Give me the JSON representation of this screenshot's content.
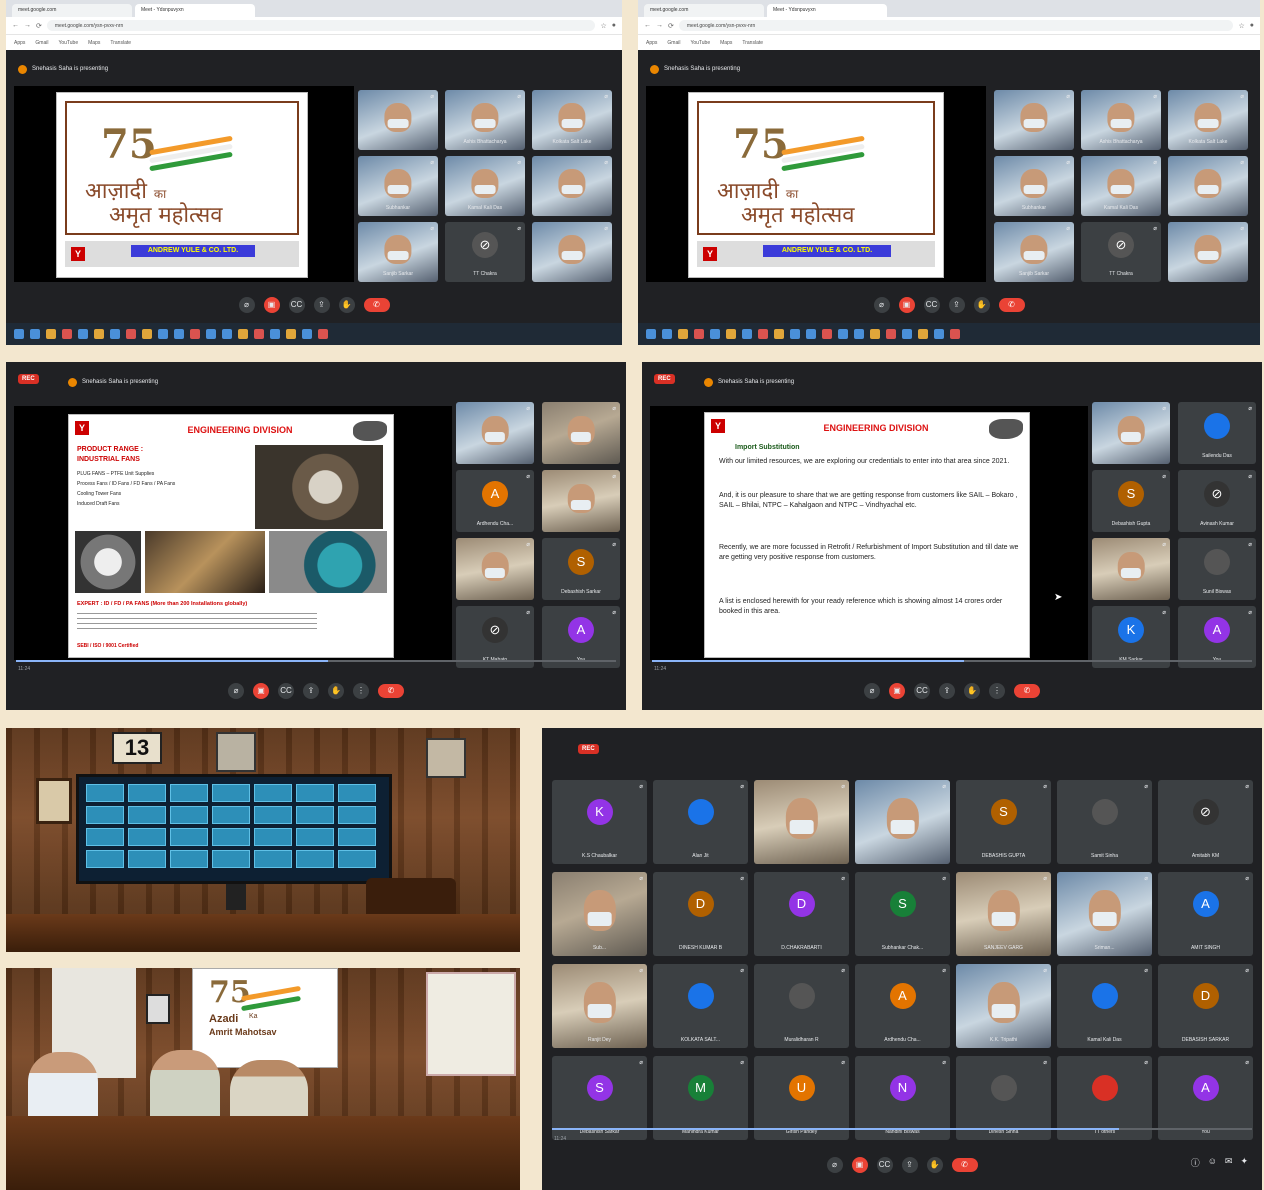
{
  "colors": {
    "meet_bg": "#202124",
    "tile_bg": "#3c4043",
    "hangup_red": "#ea4335",
    "rec_red": "#d93025",
    "presenting_dot": "#ea8600",
    "accent_blue": "#1a73e8",
    "background": "#f3e7cf"
  },
  "icons": [
    "mic-off-icon",
    "camera-icon",
    "captions-icon",
    "present-icon",
    "raise-hand-icon",
    "more-icon",
    "hangup-icon",
    "info-icon",
    "people-icon",
    "chat-icon",
    "activities-icon",
    "pin-icon",
    "back-icon",
    "forward-icon",
    "reload-icon",
    "star-icon",
    "profile-icon"
  ],
  "browser": {
    "tab1": "meet.google.com",
    "tab2": "Meet - Ydsnpuvyxn",
    "address": "meet.google.com/ysn-pvxv-nrn",
    "bookmarks": [
      "Apps",
      "Gmail",
      "YouTube",
      "Maps",
      "Translate"
    ]
  },
  "screens": {
    "presenting": "Snehasis Saha is presenting",
    "presenting_b": "Snehasis Saha is presenting",
    "rec": "REC",
    "meeting_code": "ysn-pvxv-nrn",
    "time": "11:24"
  },
  "logo_slide": {
    "seventyfive": "75",
    "hindi1": "आज़ादी",
    "ka": "का",
    "hindi2": "अमृत महोत्सव",
    "company": "ANDREW YULE & CO. LTD.",
    "company_logo": "Y"
  },
  "top_tiles": [
    {
      "name": "",
      "type": "video"
    },
    {
      "name": "Ashis Bhattacharya",
      "type": "video"
    },
    {
      "name": "Kolkata Salt Lake",
      "type": "video"
    },
    {
      "name": "Subhankar",
      "type": "video"
    },
    {
      "name": "Kamal Kali Das",
      "type": "video"
    },
    {
      "name": "",
      "type": "video"
    },
    {
      "name": "Sanjib Sarkar",
      "type": "video"
    },
    {
      "name": "TT Chakra",
      "type": "avatar",
      "letter": "⊘"
    },
    {
      "name": "",
      "type": "video"
    }
  ],
  "slide_eng": {
    "title": "ENGINEERING DIVISION",
    "heading1": "PRODUCT RANGE :",
    "heading2": "INDUSTRIAL FANS",
    "bullets": [
      "PLUG FANS – PTFE Unit Supplies",
      "Process Fans / ID Fans / FD Fans / PA Fans",
      "Cooling Tower Fans",
      "Induced Draft Fans"
    ],
    "expert": "EXPERT : ID / FD / PA FANS (More than 200 Installations globally)",
    "footer": "SEBI / ISO / 9001 Certified"
  },
  "slide_import": {
    "title": "ENGINEERING DIVISION",
    "sub": "Import Substitution",
    "bullets": [
      "With our limited resources, we are exploring our credentials to enter into that area since 2021.",
      "And, it is our pleasure to share that we are getting response from customers like SAIL – Bokaro , SAIL – Bhilai, NTPC – Kahalgaon and NTPC – Vindhyachal etc.",
      "Recently, we are more focussed in Retrofit / Refurbishment of Import Substitution and till date we are getting very positive response from customers.",
      "A list is enclosed herewith for your ready reference which is showing almost 14 crores order booked in this area."
    ]
  },
  "mid_tiles_left": [
    {
      "name": "",
      "type": "video"
    },
    {
      "name": "",
      "type": "video"
    },
    {
      "name": "Ardhendu Cha...",
      "type": "avatar",
      "letter": "A",
      "color": "#e37400"
    },
    {
      "name": "",
      "type": "video"
    },
    {
      "name": "",
      "type": "video"
    },
    {
      "name": "Debashish Sarkar",
      "type": "avatar",
      "letter": "S",
      "color": "#b06000"
    },
    {
      "name": "KT Mahato",
      "type": "avatar",
      "letter": "⊘",
      "color": "#333"
    },
    {
      "name": "You",
      "type": "avatar",
      "letter": "A",
      "color": "#9334e6"
    }
  ],
  "mid_tiles_right": [
    {
      "name": "",
      "type": "video"
    },
    {
      "name": "Sailendu Das",
      "type": "avatar",
      "letter": "",
      "color": "#1a73e8"
    },
    {
      "name": "Debashish Gupta",
      "type": "avatar",
      "letter": "S",
      "color": "#b06000"
    },
    {
      "name": "Avinash Kumar",
      "type": "avatar",
      "letter": "⊘",
      "color": "#333"
    },
    {
      "name": "",
      "type": "video"
    },
    {
      "name": "Sunil Biswas",
      "type": "avatar",
      "letter": "",
      "color": "#555"
    },
    {
      "name": "KM Sarkar",
      "type": "avatar",
      "letter": "K",
      "color": "#1a73e8"
    },
    {
      "name": "You",
      "type": "avatar",
      "letter": "A",
      "color": "#9334e6"
    }
  ],
  "grid_tiles": [
    {
      "name": "K.S Chaubalkar",
      "letter": "K",
      "color": "#9334e6",
      "type": "avatar"
    },
    {
      "name": "Alan Jit",
      "letter": "",
      "color": "#1a73e8",
      "type": "avatar"
    },
    {
      "name": "",
      "type": "video"
    },
    {
      "name": "",
      "type": "video"
    },
    {
      "name": "DEBASHIS GUPTA",
      "letter": "S",
      "color": "#b06000",
      "type": "avatar"
    },
    {
      "name": "Samit Sinha",
      "letter": "",
      "color": "#555",
      "type": "avatar"
    },
    {
      "name": "Amitabh KM",
      "letter": "⊘",
      "color": "#333",
      "type": "avatar"
    },
    {
      "name": "Sub...",
      "type": "video"
    },
    {
      "name": "DINESH KUMAR B",
      "letter": "D",
      "color": "#b06000",
      "type": "avatar"
    },
    {
      "name": "D.CHAKRABARTI",
      "letter": "D",
      "color": "#9334e6",
      "type": "avatar"
    },
    {
      "name": "Subhankar Chak...",
      "letter": "S",
      "color": "#188038",
      "type": "avatar"
    },
    {
      "name": "SANJEEV GARG",
      "type": "video"
    },
    {
      "name": "Sriman...",
      "type": "video"
    },
    {
      "name": "AMIT SINGH",
      "letter": "A",
      "color": "#1a73e8",
      "type": "avatar"
    },
    {
      "name": "Ranjit Dey",
      "type": "video"
    },
    {
      "name": "KOLKATA SALT...",
      "letter": "",
      "color": "#1a73e8",
      "type": "avatar"
    },
    {
      "name": "Muralidharan R",
      "letter": "",
      "color": "#555",
      "type": "avatar"
    },
    {
      "name": "Ardhendu Cha...",
      "letter": "A",
      "color": "#e37400",
      "type": "avatar"
    },
    {
      "name": "K.K. Tripathi",
      "type": "video"
    },
    {
      "name": "Kamal Kali Das",
      "letter": "",
      "color": "#1a73e8",
      "type": "avatar"
    },
    {
      "name": "DEBASISH SARKAR",
      "letter": "D",
      "color": "#b06000",
      "type": "avatar"
    },
    {
      "name": "Debashish Sarkar",
      "letter": "S",
      "color": "#9334e6",
      "type": "avatar"
    },
    {
      "name": "Mahindra Kumar",
      "letter": "M",
      "color": "#188038",
      "type": "avatar"
    },
    {
      "name": "Girish Pandey",
      "letter": "U",
      "color": "#e37400",
      "type": "avatar"
    },
    {
      "name": "Nandini Biswas",
      "letter": "N",
      "color": "#9334e6",
      "type": "avatar"
    },
    {
      "name": "Dinesh Sinha",
      "letter": "",
      "color": "#555",
      "type": "avatar"
    },
    {
      "name": "TT others",
      "letter": "",
      "color": "#d93025",
      "type": "avatar"
    },
    {
      "name": "You",
      "letter": "A",
      "color": "#9334e6",
      "type": "avatar"
    }
  ],
  "photo_room": {
    "clock_number": "13"
  },
  "photo_people": {
    "banner_75": "75",
    "banner_text1": "Azadi",
    "banner_text2": "Ka",
    "banner_text3": "Amrit Mahotsav"
  }
}
